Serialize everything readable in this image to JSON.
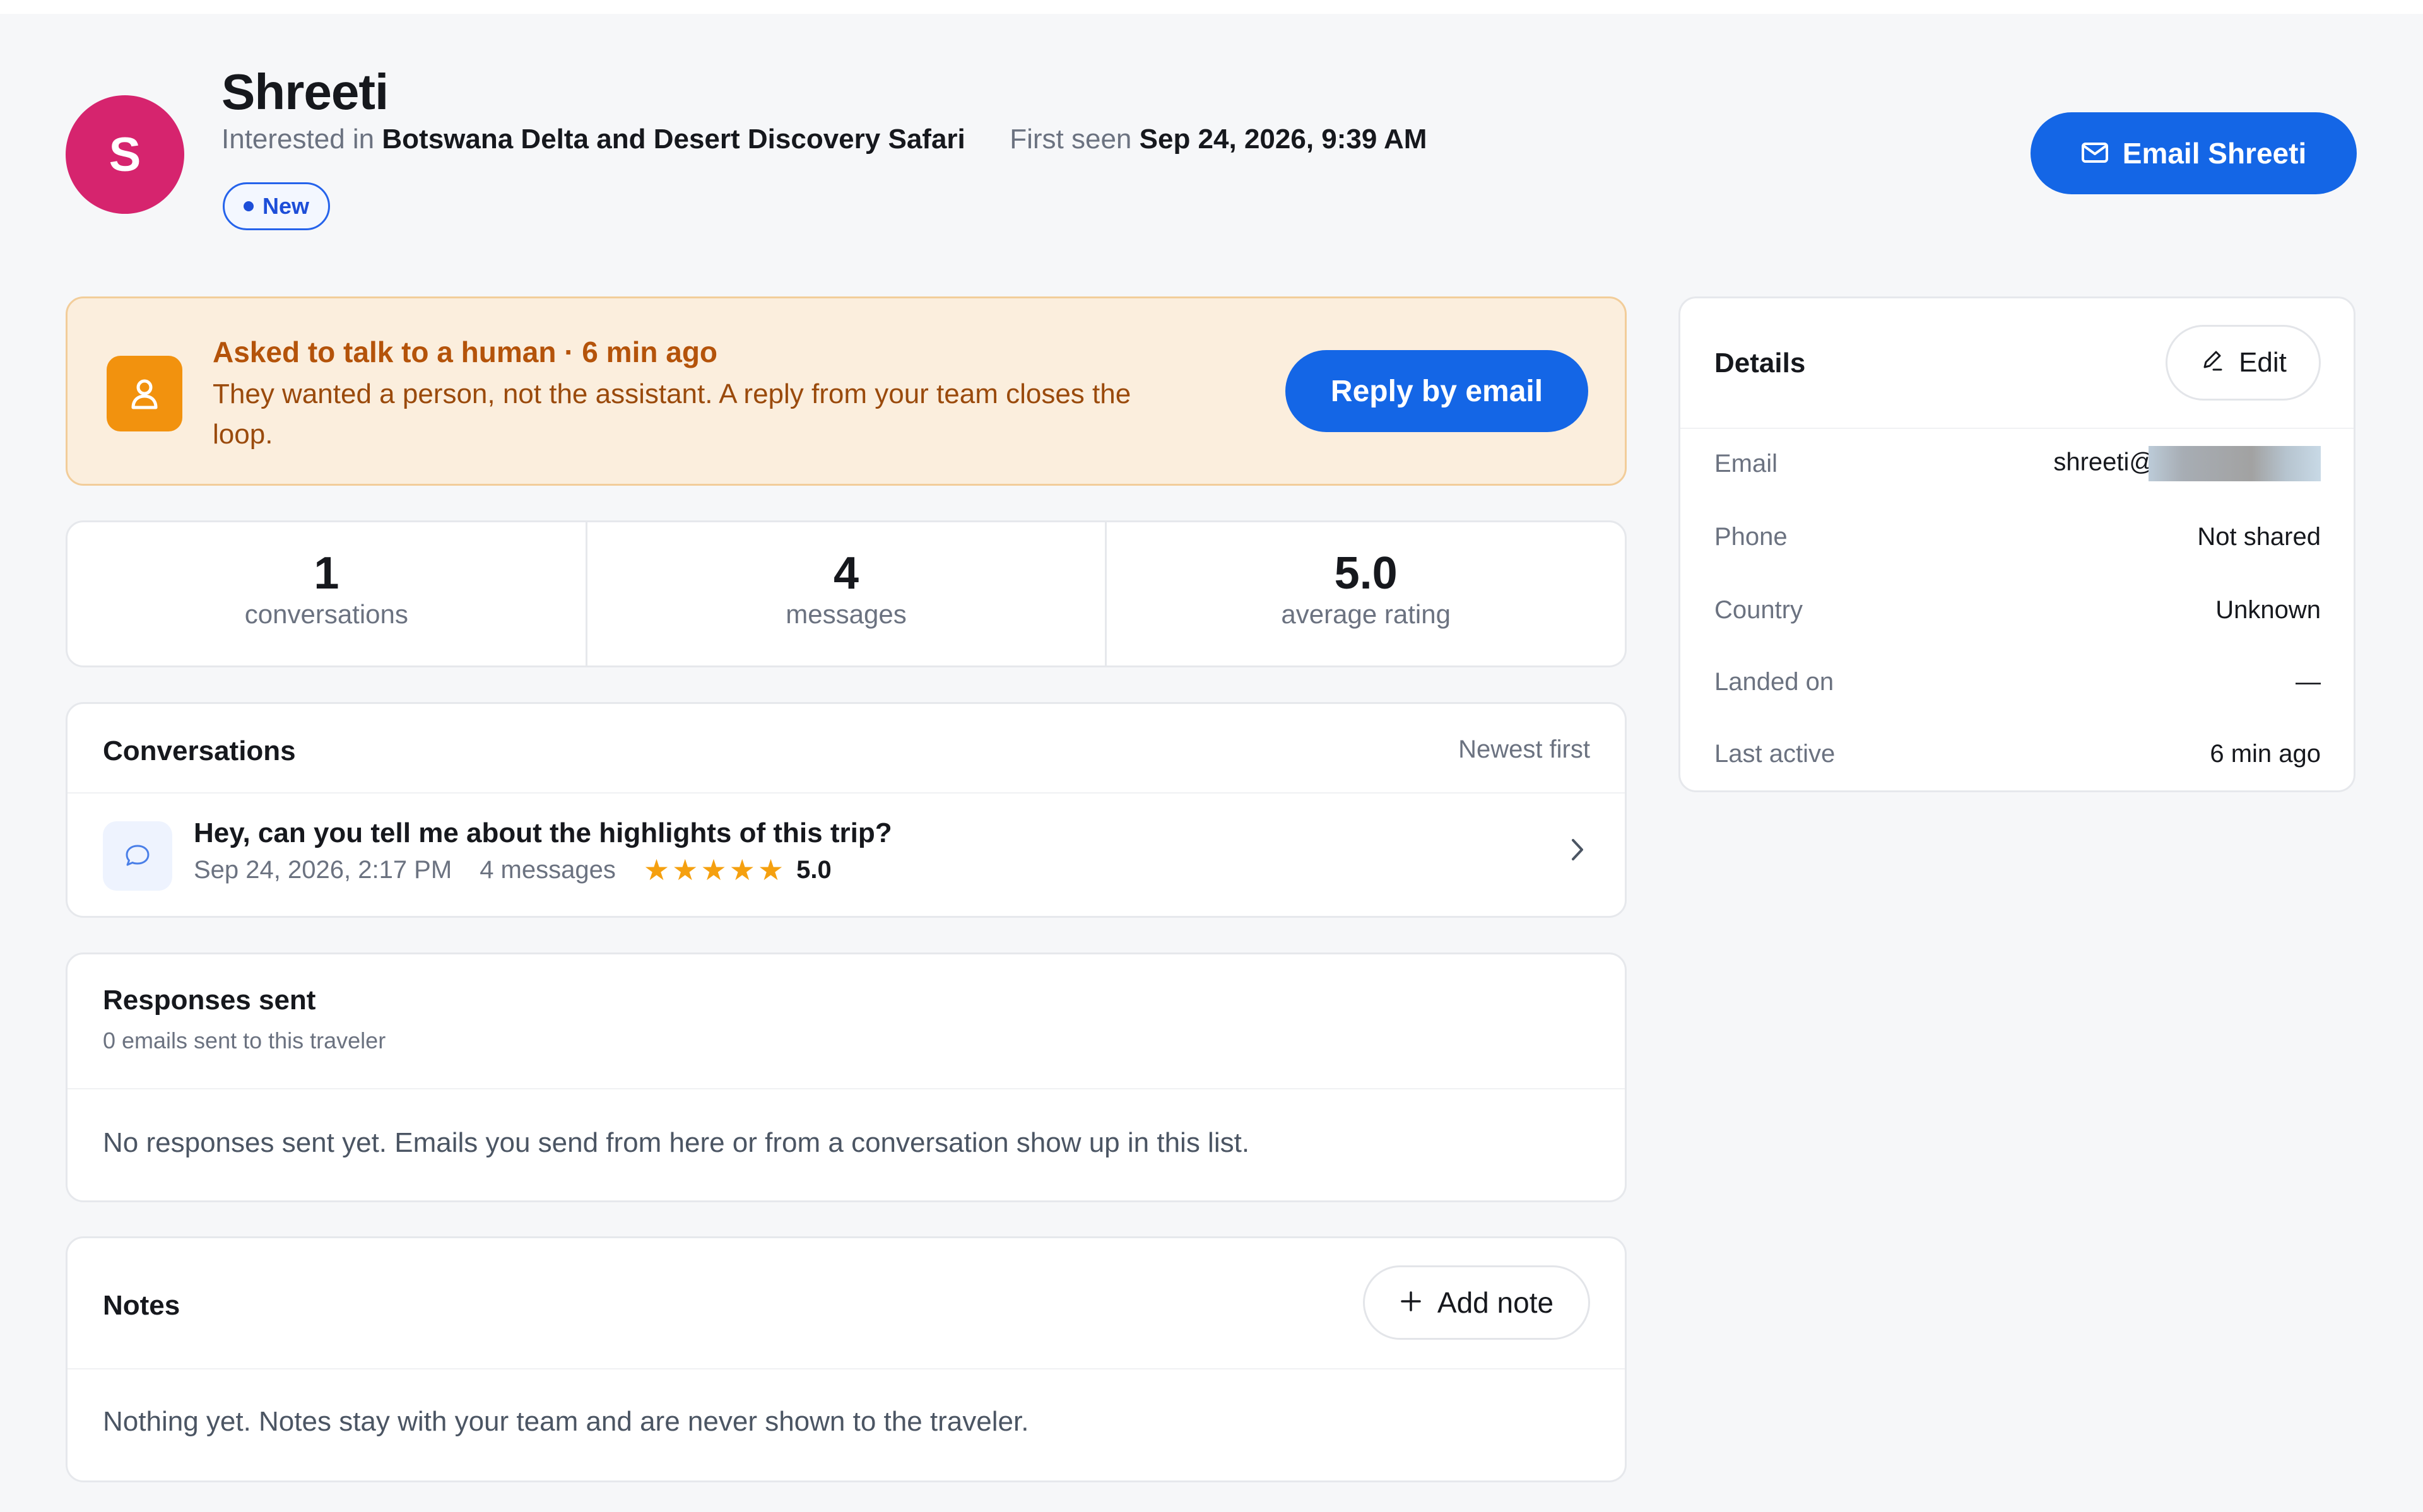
{
  "profile": {
    "initial": "S",
    "name": "Shreeti",
    "interested_label": "Interested in",
    "interested_value": "Botswana Delta and Desert Discovery Safari",
    "first_seen_label": "First seen",
    "first_seen_value": "Sep 24, 2026, 9:39 AM",
    "status_badge": "New",
    "avatar_color": "#d6246e"
  },
  "email_button": {
    "label": "Email Shreeti",
    "icon": "mail-icon"
  },
  "alert": {
    "title": "Asked to talk to a human · 6 min ago",
    "body": "They wanted a person, not the assistant. A reply from your team closes the loop.",
    "button_label": "Reply by email",
    "icon": "person-icon",
    "accent": "#f2920e"
  },
  "stats": [
    {
      "value": "1",
      "label": "conversations"
    },
    {
      "value": "4",
      "label": "messages"
    },
    {
      "value": "5.0",
      "label": "average rating"
    }
  ],
  "conversations": {
    "title": "Conversations",
    "sort": "Newest first",
    "items": [
      {
        "question": "Hey, can you tell me about the highlights of this trip?",
        "date": "Sep 24, 2026, 2:17 PM",
        "messages": "4 messages",
        "stars": 5,
        "rating": "5.0"
      }
    ]
  },
  "responses": {
    "title": "Responses sent",
    "subtitle": "0 emails sent to this traveler",
    "empty": "No responses sent yet. Emails you send from here or from a conversation show up in this list."
  },
  "notes": {
    "title": "Notes",
    "add_label": "Add note",
    "empty": "Nothing yet. Notes stay with your team and are never shown to the traveler."
  },
  "details": {
    "title": "Details",
    "edit_label": "Edit",
    "rows": [
      {
        "label": "Email",
        "value": "shreeti@"
      },
      {
        "label": "Phone",
        "value": "Not shared"
      },
      {
        "label": "Country",
        "value": "Unknown"
      },
      {
        "label": "Landed on",
        "value": "—"
      },
      {
        "label": "Last active",
        "value": "6 min ago"
      }
    ]
  },
  "colors": {
    "primary": "#1466e6",
    "alert_bg": "#fbeedd",
    "star": "#f5a00f"
  }
}
